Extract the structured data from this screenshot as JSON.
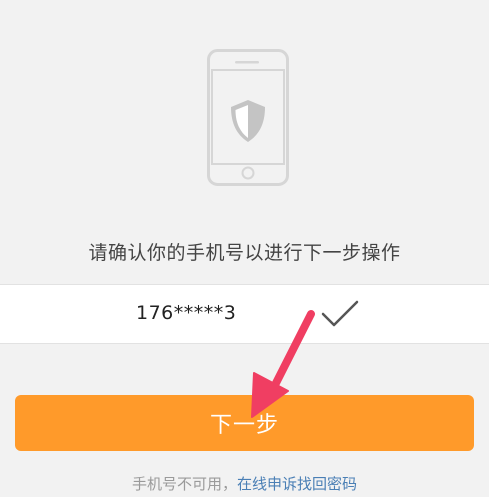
{
  "prompt": "请确认你的手机号以进行下一步操作",
  "phone": {
    "masked_number": "176*****3"
  },
  "next_button": {
    "label": "下一步"
  },
  "footer": {
    "unavailable_text": "手机号不可用，",
    "appeal_link": "在线申诉找回密码"
  },
  "icons": {
    "illustration": "phone-shield-icon",
    "confirm": "check-icon",
    "annotation": "red-arrow-icon"
  },
  "colors": {
    "background": "#f2f2f2",
    "button": "#ff9a2a",
    "link": "#4a7fb5",
    "arrow": "#f03e62",
    "check": "#555555"
  }
}
